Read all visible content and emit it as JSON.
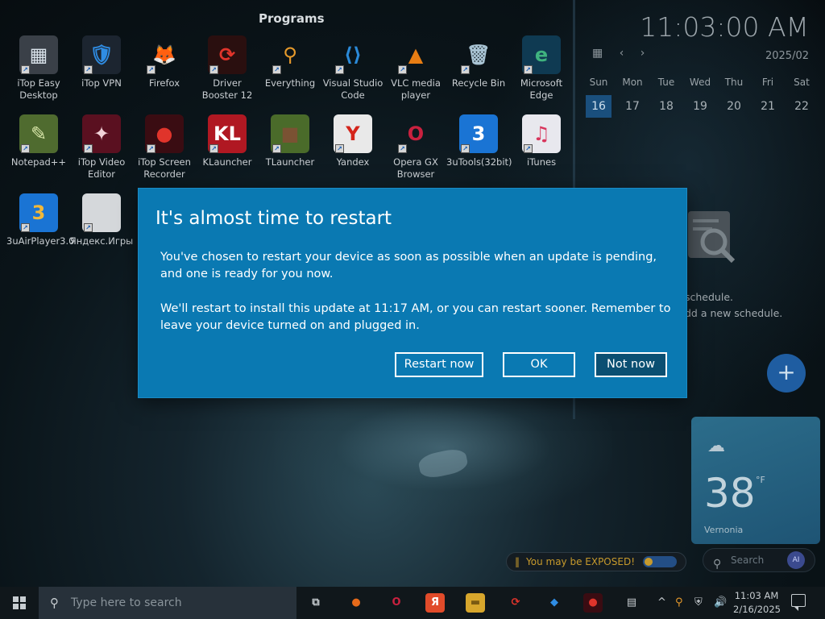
{
  "desktop": {
    "programs_title": "Programs",
    "icons": [
      {
        "label": "iTop Easy Desktop",
        "glyph": "▦",
        "color": "#3a4048",
        "fg": "#d9e2ea"
      },
      {
        "label": "iTop VPN",
        "glyph": "🛡",
        "color": "#1c2530",
        "fg": "#2f8de4"
      },
      {
        "label": "Firefox",
        "glyph": "🦊",
        "color": "transparent",
        "fg": "#e66a1a"
      },
      {
        "label": "Driver Booster 12",
        "glyph": "⟳",
        "color": "#2a0f0f",
        "fg": "#e0342b"
      },
      {
        "label": "Everything",
        "glyph": "⚲",
        "color": "transparent",
        "fg": "#e79a2b"
      },
      {
        "label": "Visual Studio Code",
        "glyph": "⟨⟩",
        "color": "transparent",
        "fg": "#2b8ad8"
      },
      {
        "label": "VLC media player",
        "glyph": "▲",
        "color": "transparent",
        "fg": "#e77d13"
      },
      {
        "label": "Recycle Bin",
        "glyph": "🗑",
        "color": "transparent",
        "fg": "#a9c4d4"
      },
      {
        "label": "Microsoft Edge",
        "glyph": "e",
        "color": "#0f3a52",
        "fg": "#3fb37f"
      },
      {
        "label": "Notepad++",
        "glyph": "✎",
        "color": "#4f6b2f",
        "fg": "#d7e5a8"
      },
      {
        "label": "iTop Video Editor",
        "glyph": "✦",
        "color": "#5a1020",
        "fg": "#f1d2d8"
      },
      {
        "label": "iTop Screen Recorder",
        "glyph": "●",
        "color": "#3a0c12",
        "fg": "#e0342b"
      },
      {
        "label": "KLauncher",
        "glyph": "KL",
        "color": "#b01822",
        "fg": "#ffffff"
      },
      {
        "label": "TLauncher",
        "glyph": "■",
        "color": "#4a6b2a",
        "fg": "#7a5233"
      },
      {
        "label": "Yandex",
        "glyph": "Y",
        "color": "#e9e9e9",
        "fg": "#d4241a"
      },
      {
        "label": "Opera GX Browser",
        "glyph": "O",
        "color": "transparent",
        "fg": "#c9213f"
      },
      {
        "label": "3uTools(32bit)",
        "glyph": "3",
        "color": "#1a74d4",
        "fg": "#ffffff"
      },
      {
        "label": "iTunes",
        "glyph": "♫",
        "color": "#e8e8ee",
        "fg": "#d8355c"
      },
      {
        "label": "3uAirPlayer3.0",
        "glyph": "3",
        "color": "#1a74d4",
        "fg": "#f1b83a"
      },
      {
        "label": "Яндекс.Игры",
        "glyph": "",
        "color": "#d5d8db",
        "fg": "#666"
      }
    ]
  },
  "widgets": {
    "clock": "11:03:00 AM",
    "calendar_date": "2025/02",
    "calendar_prev": "‹",
    "calendar_next": "›",
    "calendar_icon": "▦",
    "weekdays": [
      "Sun",
      "Mon",
      "Tue",
      "Wed",
      "Thu",
      "Fri",
      "Sat"
    ],
    "days": [
      "16",
      "17",
      "18",
      "19",
      "20",
      "21",
      "22"
    ],
    "schedule_text1": "schedule.",
    "schedule_text2": "dd a new schedule.",
    "add_label": "+",
    "weather_temp": "38",
    "weather_unit": "°F",
    "weather_location": "Vernonia",
    "exposed_text": "You may be EXPOSED!",
    "side_search_placeholder": "Search",
    "ai_badge": "AI"
  },
  "dialog": {
    "title": "It's almost time to restart",
    "paragraph1": "You've chosen to restart your device as soon as possible when an update is pending, and one is ready for you now.",
    "paragraph2": "We'll restart to install this update at 11:17 AM, or you can restart sooner. Remember to leave your device turned on and plugged in.",
    "restart_now": "Restart now",
    "ok": "OK",
    "not_now": "Not now"
  },
  "taskbar": {
    "search_placeholder": "Type here to search",
    "time": "11:03 AM",
    "date": "2/16/2025",
    "apps": [
      {
        "name": "task-view-icon",
        "glyph": "⧉",
        "color": "transparent",
        "fg": "#c7cdd1"
      },
      {
        "name": "firefox-icon",
        "glyph": "●",
        "color": "transparent",
        "fg": "#e66a1a"
      },
      {
        "name": "opera-gx-icon",
        "glyph": "O",
        "color": "transparent",
        "fg": "#c9213f"
      },
      {
        "name": "yandex-icon",
        "glyph": "Я",
        "color": "#e14b2a",
        "fg": "#ffffff"
      },
      {
        "name": "file-explorer-icon",
        "glyph": "▬",
        "color": "#d7a62c",
        "fg": "#7a5a12"
      },
      {
        "name": "driver-booster-icon",
        "glyph": "⟳",
        "color": "transparent",
        "fg": "#e0342b"
      },
      {
        "name": "itop-vpn-icon",
        "glyph": "◆",
        "color": "transparent",
        "fg": "#2f8de4"
      },
      {
        "name": "screen-recorder-icon",
        "glyph": "●",
        "color": "#3a0c12",
        "fg": "#e0342b"
      },
      {
        "name": "itop-desktop-icon",
        "glyph": "▤",
        "color": "transparent",
        "fg": "#c7cdd1"
      }
    ],
    "tray": [
      "^",
      "⚲",
      "⛨",
      "🔊"
    ]
  }
}
